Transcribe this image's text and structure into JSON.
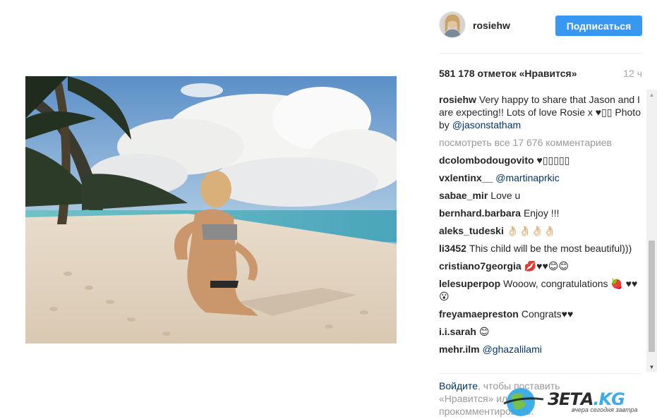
{
  "post": {
    "image_alt": "Beach photo",
    "header": {
      "username": "rosiehw",
      "follow_label": "Подписаться"
    },
    "likes_text": "581 178 отметок «Нравится»",
    "timestamp": "12 ч",
    "caption": {
      "user": "rosiehw",
      "text": "Very happy to share that Jason and I are expecting!! Lots of love Rosie x ♥▯▯ Photo by ",
      "mention": "@jasonstatham"
    },
    "view_all": "посмотреть все 17 676 комментариев",
    "comments": [
      {
        "user": "dcolombodougovito",
        "text": "♥▯▯▯▯▯",
        "mention": ""
      },
      {
        "user": "vxlentinx__",
        "text": "",
        "mention": "@martinaprkic"
      },
      {
        "user": "sabae_mir",
        "text": "Love u",
        "mention": ""
      },
      {
        "user": "bernhard.barbara",
        "text": "Enjoy !!!",
        "mention": ""
      },
      {
        "user": "aleks_tudeski",
        "text": "👌🏻👌🏻👌🏻👌🏻",
        "mention": ""
      },
      {
        "user": "li3452",
        "text": "This child will be the most beautiful)))",
        "mention": ""
      },
      {
        "user": "cristiano7georgia",
        "text": "💋♥♥😊😊",
        "mention": ""
      },
      {
        "user": "lelesuperpop",
        "text": "Wooow, congratulations 🍓 ♥♥😮",
        "mention": ""
      },
      {
        "user": "freyamaepreston",
        "text": "Congrats♥♥",
        "mention": ""
      },
      {
        "user": "i.i.sarah",
        "text": "😊",
        "mention": ""
      },
      {
        "user": "mehr.ilm",
        "text": "",
        "mention": "@ghazalilami"
      }
    ],
    "login_prompt": {
      "link": "Войдите",
      "text": ", чтобы поставить «Нравится» или прокомментировать."
    }
  },
  "watermark": {
    "logo_main": "ЗЕТА",
    "logo_suffix": ".KG",
    "tagline": "вчера сегодня завтра"
  },
  "colors": {
    "accent": "#3897f0",
    "link": "#003569",
    "muted": "#999999",
    "text": "#262626"
  }
}
